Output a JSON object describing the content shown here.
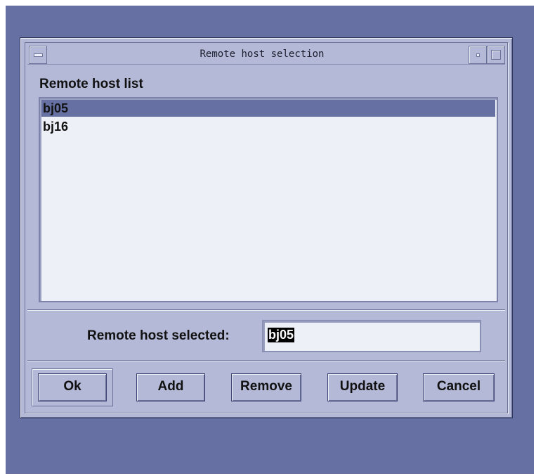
{
  "window": {
    "title": "Remote host selection"
  },
  "host_list": {
    "title": "Remote host list",
    "items": [
      {
        "label": "bj05",
        "selected": true
      },
      {
        "label": "bj16",
        "selected": false
      }
    ]
  },
  "selection": {
    "label": "Remote host selected:",
    "value": "bj05"
  },
  "buttons": {
    "ok": "Ok",
    "add": "Add",
    "remove": "Remove",
    "update": "Update",
    "cancel": "Cancel"
  },
  "colors": {
    "desktop": "#6670a3",
    "window": "#b3b9d6",
    "selection_highlight": "#6670a3",
    "list_background": "#eef0f7"
  }
}
